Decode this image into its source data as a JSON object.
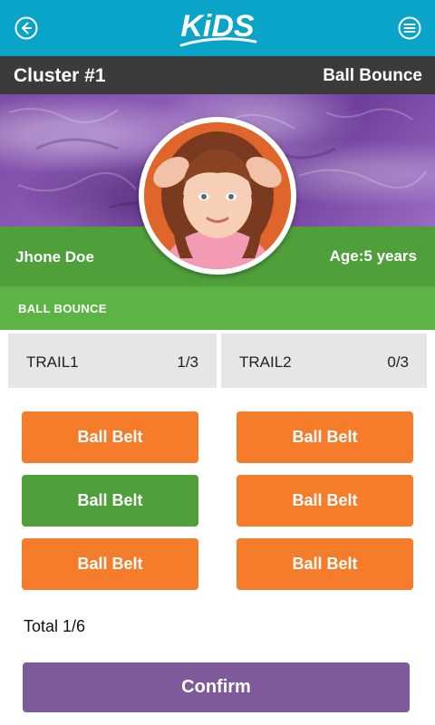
{
  "header": {
    "logo_text": "KiDS",
    "back_icon": "back-arrow-icon",
    "menu_icon": "menu-icon"
  },
  "cluster_bar": {
    "cluster": "Cluster #1",
    "activity": "Ball Bounce"
  },
  "profile": {
    "name": "Jhone Doe",
    "age": "Age:5 years"
  },
  "section": {
    "title": "BALL BOUNCE"
  },
  "trails": [
    {
      "label": "TRAIL1",
      "count": "1/3"
    },
    {
      "label": "TRAIL2",
      "count": "0/3"
    }
  ],
  "buttons": [
    {
      "label": "Ball Belt",
      "state": "pending"
    },
    {
      "label": "Ball Belt",
      "state": "pending"
    },
    {
      "label": "Ball Belt",
      "state": "done"
    },
    {
      "label": "Ball Belt",
      "state": "pending"
    },
    {
      "label": "Ball Belt",
      "state": "pending"
    },
    {
      "label": "Ball Belt",
      "state": "pending"
    }
  ],
  "total": "Total 1/6",
  "confirm_label": "Confirm",
  "colors": {
    "header": "#0aa4c9",
    "cluster_bar": "#3b3b3b",
    "green": "#4fa03b",
    "section_green": "#5db346",
    "orange": "#f57c2b",
    "purple": "#7f5a9b"
  }
}
